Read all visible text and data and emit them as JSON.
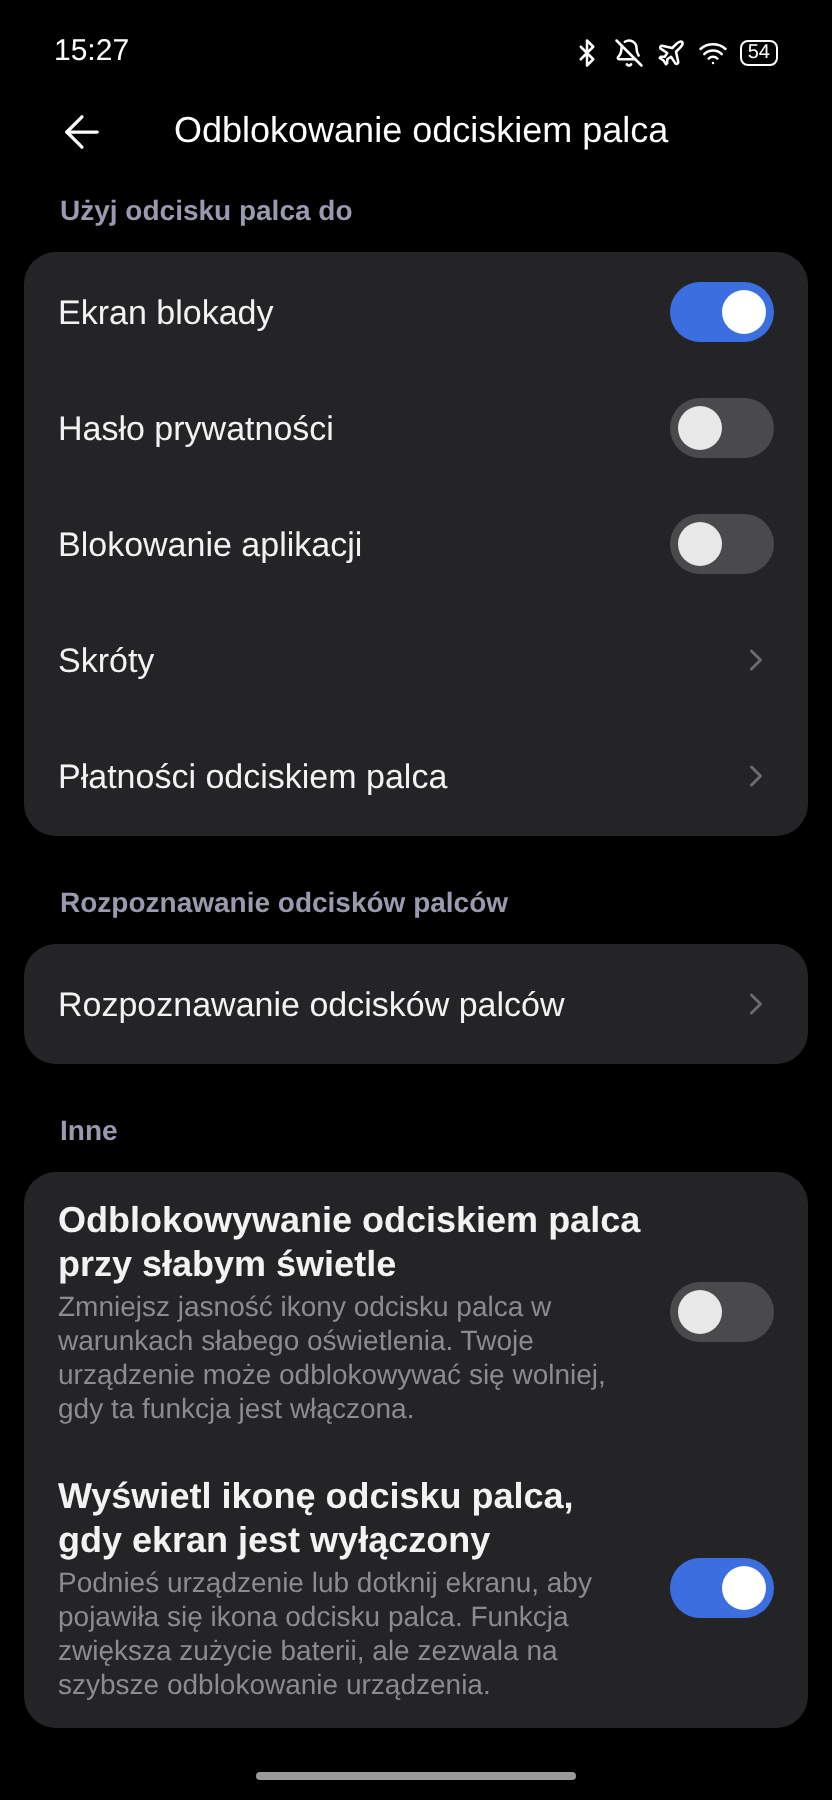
{
  "status_bar": {
    "time": "15:27",
    "battery": "54"
  },
  "header": {
    "title": "Odblokowanie odciskiem palca"
  },
  "sections": [
    {
      "label": "Użyj odcisku palca do",
      "items": [
        {
          "kind": "toggle",
          "title": "Ekran blokady",
          "on": true
        },
        {
          "kind": "toggle",
          "title": "Hasło prywatności",
          "on": false
        },
        {
          "kind": "toggle",
          "title": "Blokowanie aplikacji",
          "on": false
        },
        {
          "kind": "link",
          "title": "Skróty"
        },
        {
          "kind": "link",
          "title": "Płatności odciskiem palca"
        }
      ]
    },
    {
      "label": "Rozpoznawanie odcisków palców",
      "items": [
        {
          "kind": "link",
          "title": "Rozpoznawanie odcisków palców"
        }
      ]
    },
    {
      "label": "Inne",
      "items": [
        {
          "kind": "toggle",
          "title": "Odblokowywanie odciskiem palca przy słabym świetle",
          "description": "Zmniejsz jasność ikony odcisku palca w warunkach słabego oświetlenia. Twoje urządzenie może odblokowywać się wolniej, gdy ta funkcja jest włączona.",
          "on": false
        },
        {
          "kind": "toggle",
          "title": "Wyświetl ikonę odcisku palca, gdy ekran jest wyłączony",
          "description": "Podnieś urządzenie lub dotknij ekranu, aby pojawiła się ikona odcisku palca. Funkcja zwiększa zużycie baterii, ale zezwala na szybsze odblokowanie urządzenia.",
          "on": true
        }
      ]
    }
  ]
}
